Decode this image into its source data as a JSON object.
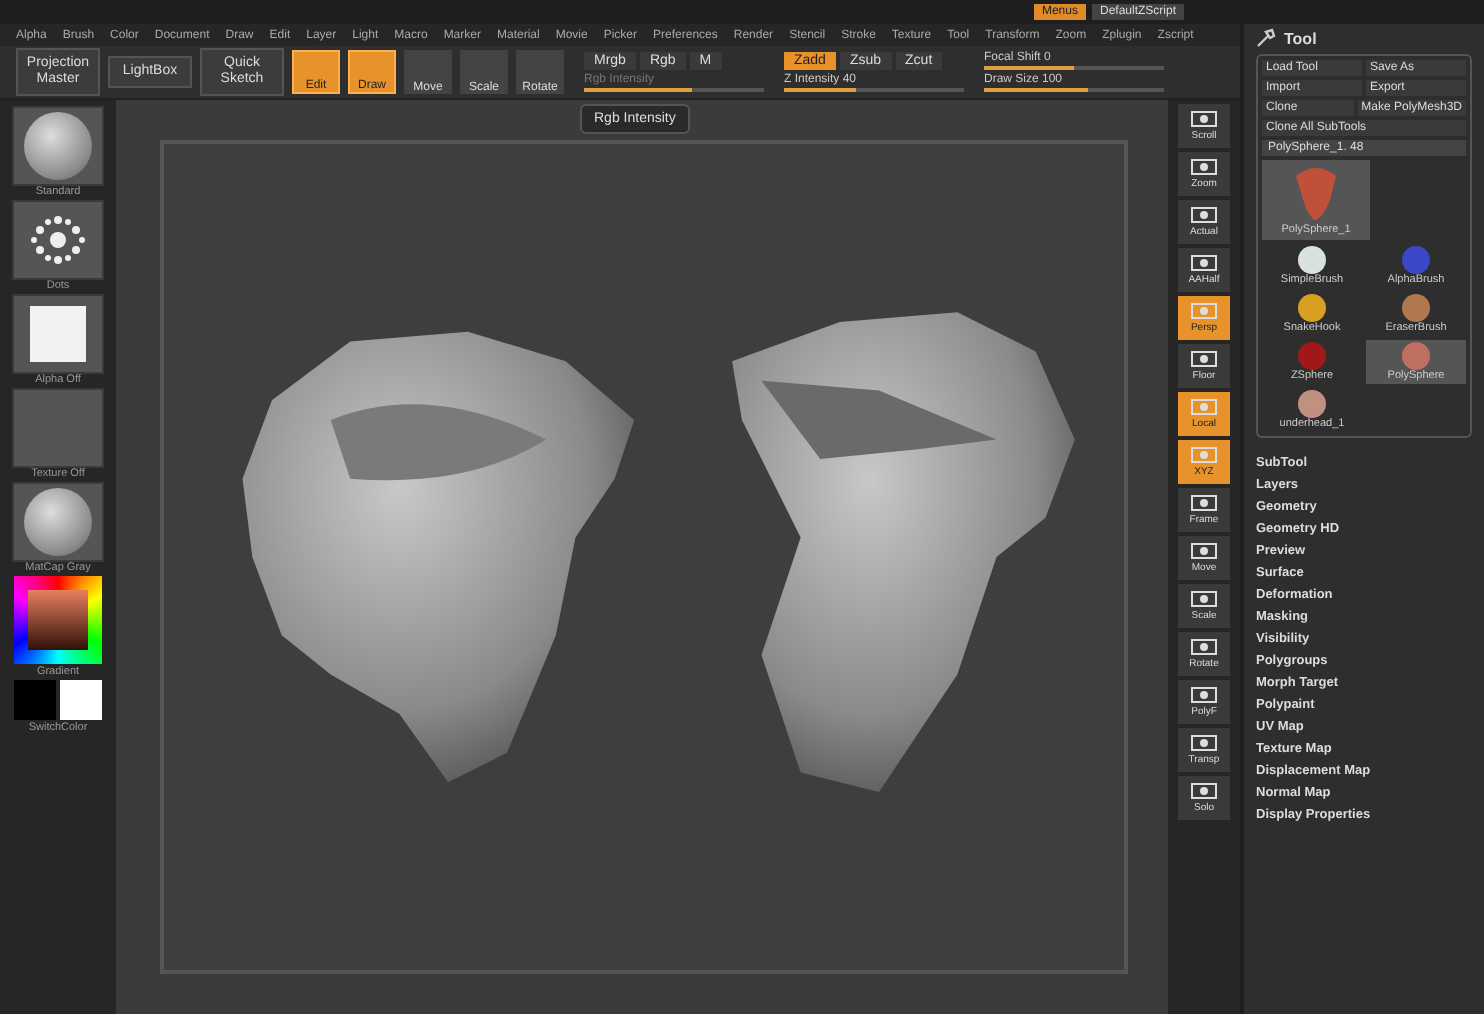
{
  "title_bar": {
    "buttons": [
      {
        "label": "Menus",
        "selected": true
      },
      {
        "label": "DefaultZScript",
        "selected": false
      }
    ]
  },
  "menu_bar": [
    "Alpha",
    "Brush",
    "Color",
    "Document",
    "Draw",
    "Edit",
    "Layer",
    "Light",
    "Macro",
    "Marker",
    "Material",
    "Movie",
    "Picker",
    "Preferences",
    "Render",
    "Stencil",
    "Stroke",
    "Texture",
    "Tool",
    "Transform",
    "Zoom",
    "Zplugin",
    "Zscript"
  ],
  "toolbar": {
    "buttons": [
      "Projection Master",
      "LightBox",
      "Quick Sketch"
    ],
    "modes": [
      {
        "label": "Edit",
        "selected": true
      },
      {
        "label": "Draw",
        "selected": true
      },
      {
        "label": "Move",
        "selected": false
      },
      {
        "label": "Scale",
        "selected": false
      },
      {
        "label": "Rotate",
        "selected": false
      }
    ],
    "color_modes": [
      {
        "label": "Mrgb",
        "selected": false
      },
      {
        "label": "Rgb",
        "selected": false
      },
      {
        "label": "M",
        "selected": false
      }
    ],
    "rgb_slider": {
      "label": "Rgb Intensity",
      "level": 0.6,
      "disabled": true
    },
    "z_modes": [
      {
        "label": "Zadd",
        "selected": true
      },
      {
        "label": "Zsub",
        "selected": false
      },
      {
        "label": "Zcut",
        "selected": false
      }
    ],
    "z_slider": {
      "label": "Z Intensity 40",
      "level": 0.4
    },
    "sliders": [
      {
        "label": "Focal Shift 0",
        "level": 0.5
      },
      {
        "label": "Draw Size 100",
        "level": 0.58
      }
    ]
  },
  "tooltip": "Rgb Intensity",
  "left_shelf": {
    "items": [
      {
        "label": "Standard",
        "kind": "sphere"
      },
      {
        "label": "Dots",
        "kind": "dots"
      },
      {
        "label": "Alpha Off",
        "kind": "square"
      },
      {
        "label": "Texture Off",
        "kind": "blank"
      },
      {
        "label": "MatCap Gray",
        "kind": "sphere"
      }
    ],
    "color_label": "Gradient",
    "switch_label": "SwitchColor"
  },
  "right_shelf": [
    {
      "label": "Scroll",
      "selected": false
    },
    {
      "label": "Zoom",
      "selected": false
    },
    {
      "label": "Actual",
      "selected": false
    },
    {
      "label": "AAHalf",
      "selected": false
    },
    {
      "label": "Persp",
      "selected": true
    },
    {
      "label": "Floor",
      "selected": false
    },
    {
      "label": "Local",
      "selected": true
    },
    {
      "label": "XYZ",
      "selected": true
    },
    {
      "label": "Frame",
      "selected": false
    },
    {
      "label": "Move",
      "selected": false
    },
    {
      "label": "Scale",
      "selected": false
    },
    {
      "label": "Rotate",
      "selected": false
    },
    {
      "label": "PolyF",
      "selected": false
    },
    {
      "label": "Transp",
      "selected": false
    },
    {
      "label": "Solo",
      "selected": false
    }
  ],
  "tool_panel": {
    "title": "Tool",
    "buttons": [
      [
        "Load Tool",
        "Save As"
      ],
      [
        "Import",
        "Export"
      ],
      [
        "Clone",
        "Make PolyMesh3D"
      ]
    ],
    "clear_button": "Clone All SubTools",
    "current": "PolySphere_1. 48",
    "preview": {
      "label": "PolySphere_1"
    },
    "tools": [
      {
        "label": "SimpleBrush",
        "color": "#d8e0e0",
        "selected": false
      },
      {
        "label": "AlphaBrush",
        "color": "#3a48c8",
        "selected": false
      },
      {
        "label": "SnakeHook",
        "color": "#d8a020",
        "selected": false
      },
      {
        "label": "EraserBrush",
        "color": "#b07850",
        "selected": false
      },
      {
        "label": "ZSphere",
        "color": "#a01818",
        "selected": false
      },
      {
        "label": "PolySphere",
        "color": "#c07060",
        "selected": true
      },
      {
        "label": "underhead_1",
        "color": "#c09080",
        "selected": false
      }
    ],
    "menu": [
      "SubTool",
      "Layers",
      "Geometry",
      "Geometry HD",
      "Preview",
      "Surface",
      "Deformation",
      "Masking",
      "Visibility",
      "Polygroups",
      "Morph Target",
      "Polypaint",
      "UV Map",
      "Texture Map",
      "Displacement Map",
      "Normal Map",
      "Display Properties"
    ]
  }
}
